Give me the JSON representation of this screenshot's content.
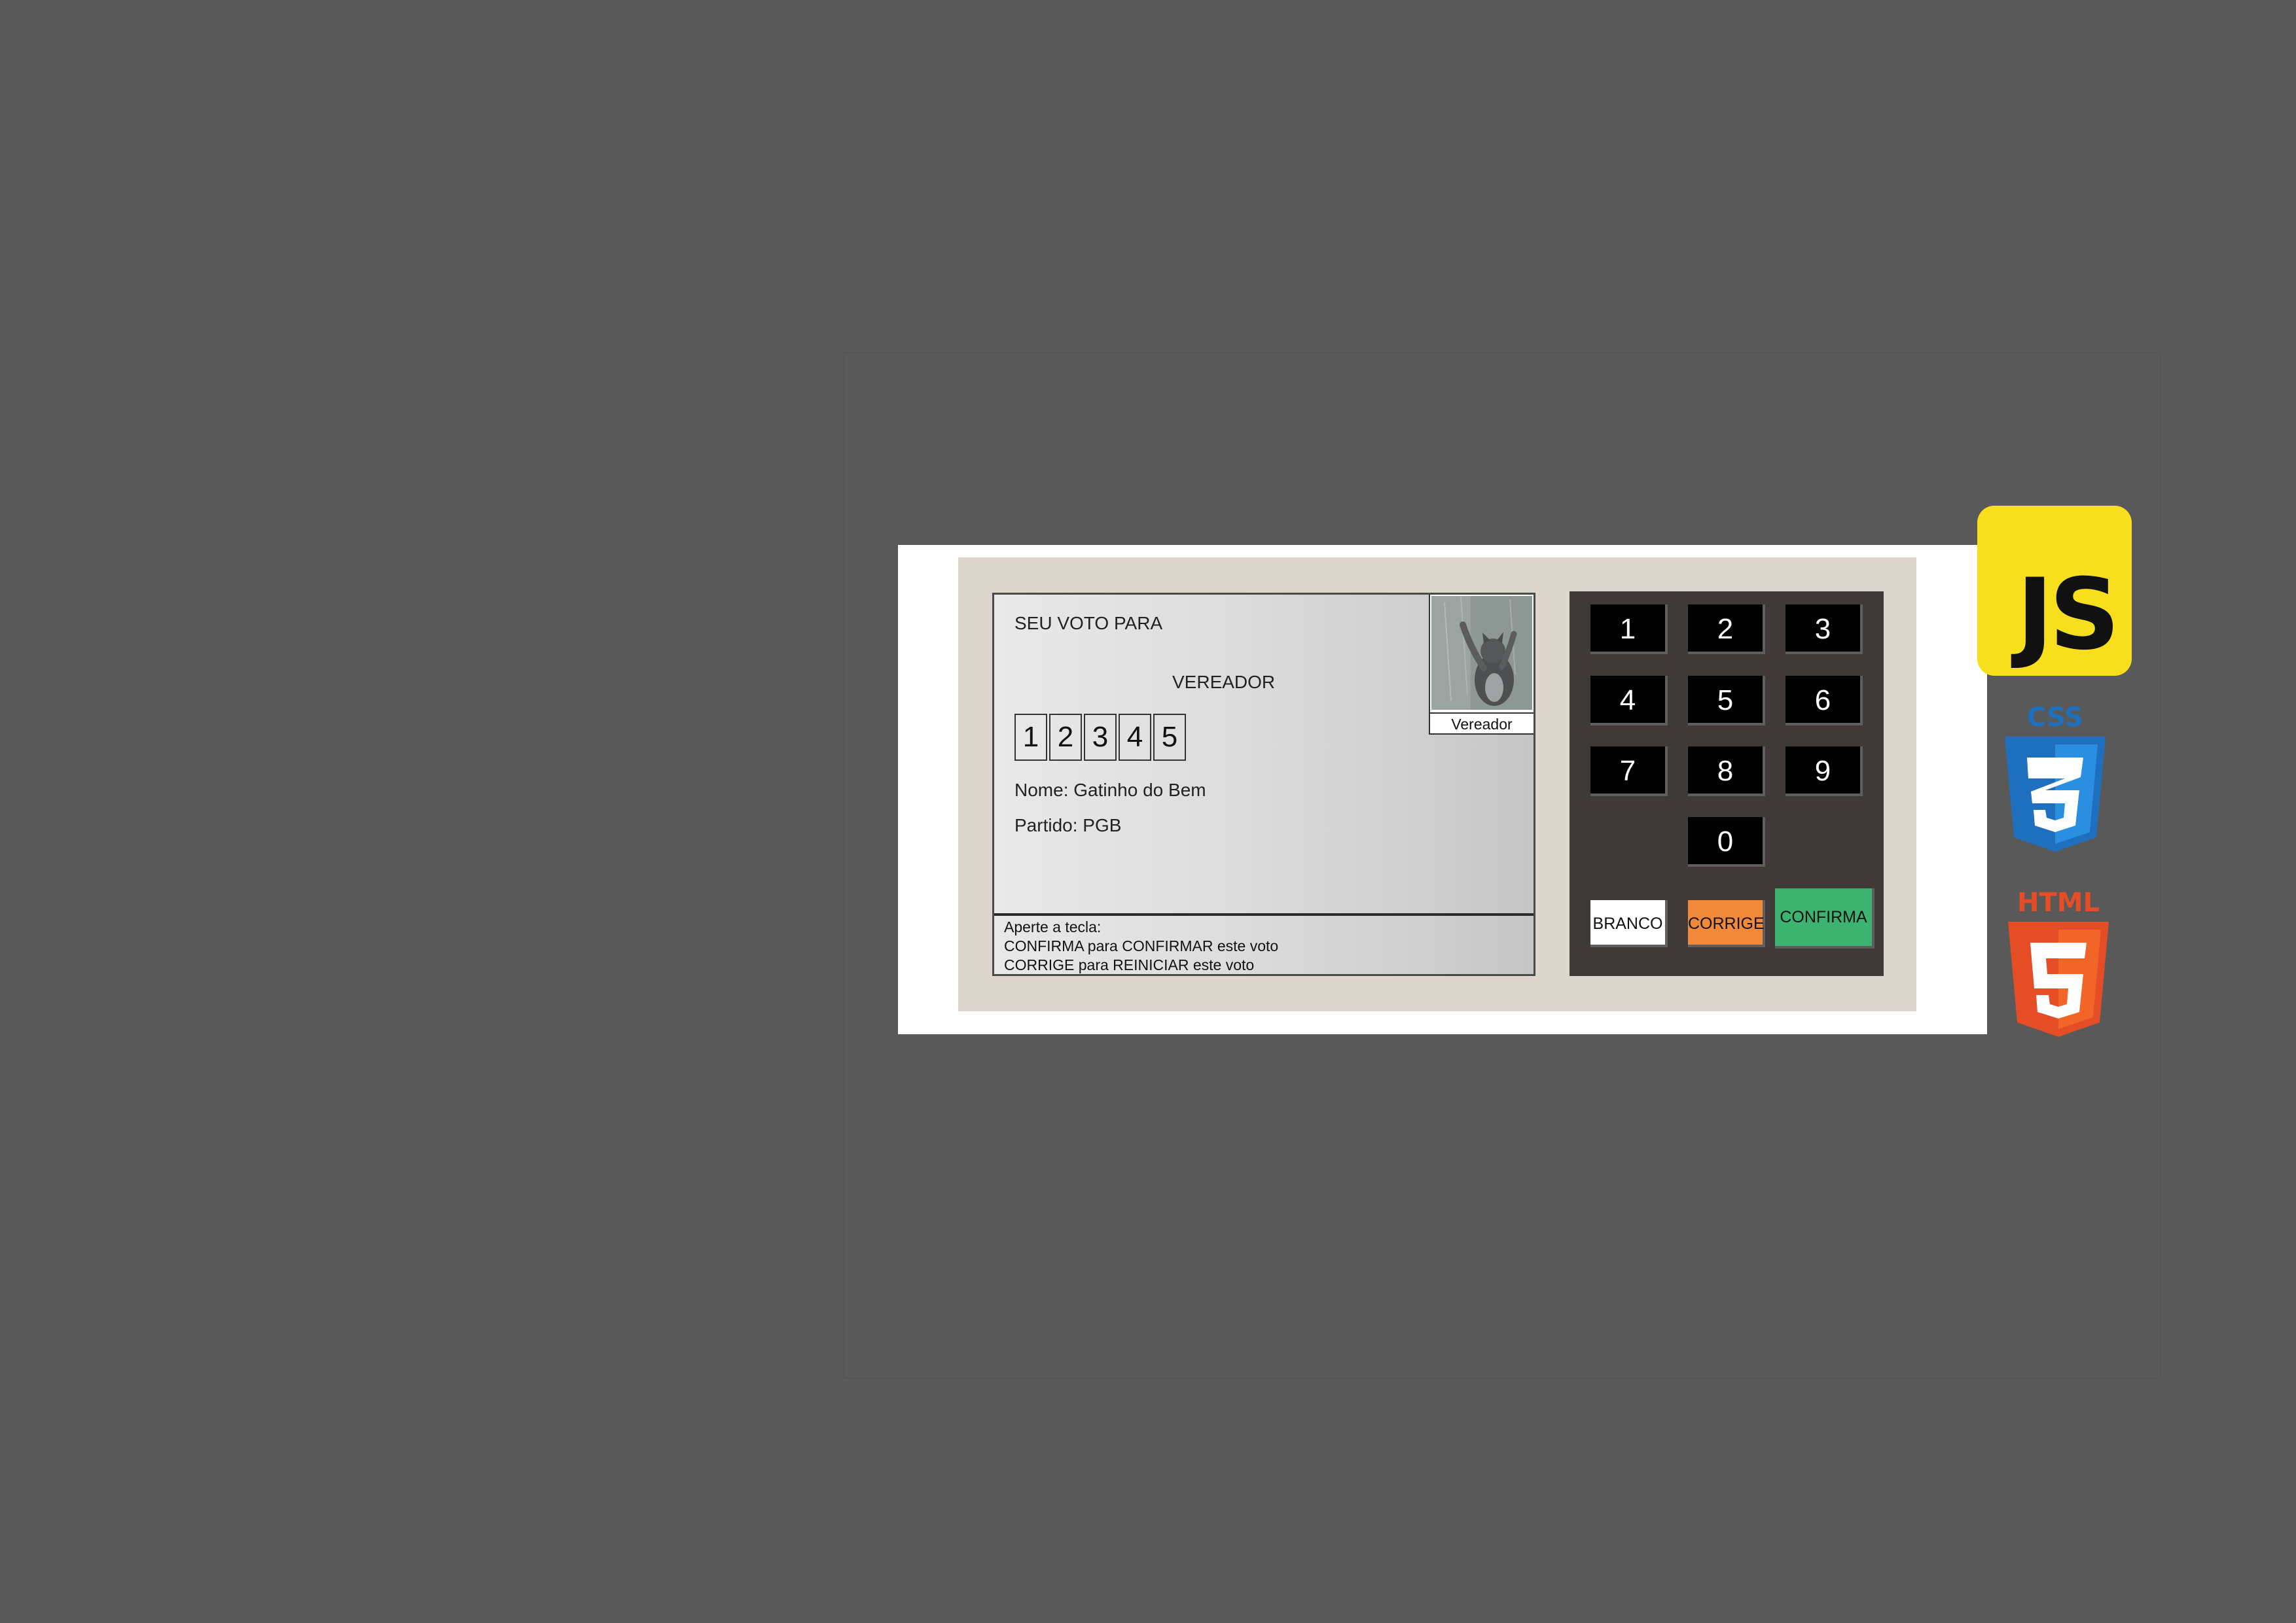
{
  "screen": {
    "header": "SEU VOTO PARA",
    "office": "VEREADOR",
    "digits": [
      "1",
      "2",
      "3",
      "4",
      "5"
    ],
    "name_line": "Nome: Gatinho do Bem",
    "party_line": "Partido: PGB",
    "photo_caption": "Vereador",
    "instructions": [
      "Aperte a tecla:",
      "CONFIRMA para CONFIRMAR este voto",
      "CORRIGE para REINICIAR este voto"
    ]
  },
  "keypad": {
    "keys": [
      "1",
      "2",
      "3",
      "4",
      "5",
      "6",
      "7",
      "8",
      "9",
      "0"
    ],
    "branco_label": "BRANCO",
    "corrige_label": "CORRIGE",
    "confirma_label": "CONFIRMA"
  },
  "colors": {
    "background": "#595959",
    "urna_body": "#ddd6cc",
    "keypad_body": "#3f3a38",
    "branco": "#ffffff",
    "corrige": "#f0893a",
    "confirma": "#3cb371",
    "js_logo": "#f7df1e",
    "css_logo": "#1f6fbf",
    "html_logo": "#e44d26"
  },
  "logos": {
    "js_text": "JS",
    "css_text": "CSS",
    "html_text": "HTML",
    "icons": [
      "javascript-logo-icon",
      "css3-logo-icon",
      "html5-logo-icon"
    ]
  }
}
